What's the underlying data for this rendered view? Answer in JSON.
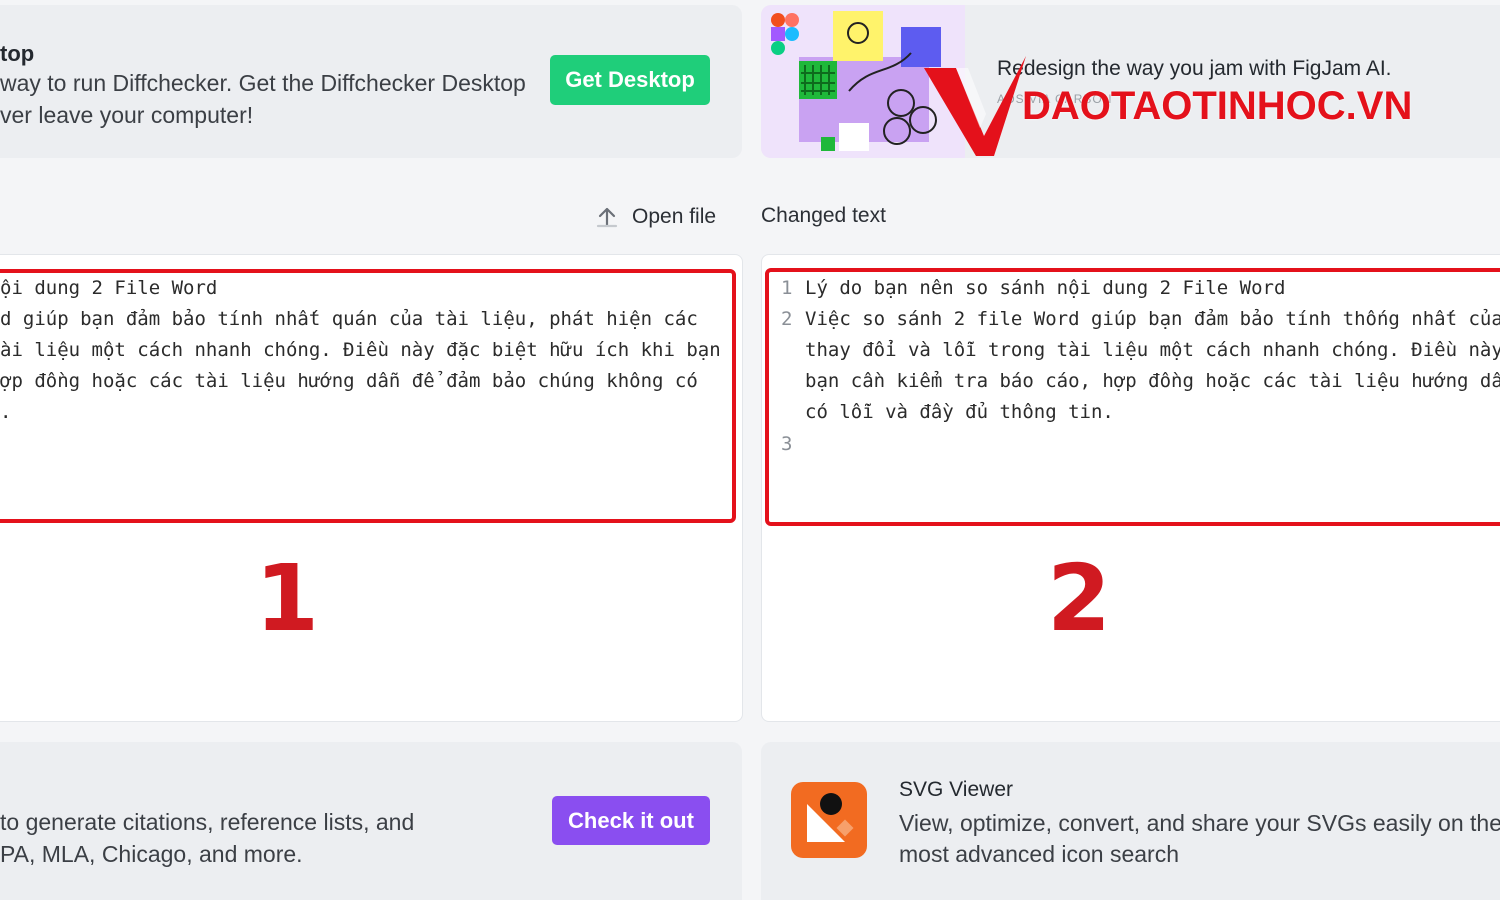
{
  "top_left_promo": {
    "title": "top",
    "line1": "way to run Diffchecker. Get the Diffchecker Desktop",
    "line2": "ver leave your computer!",
    "button": "Get Desktop"
  },
  "top_right_ad": {
    "headline": "Redesign the way you jam with FigJam AI.",
    "sub": "ADS VIA CARBON"
  },
  "watermark": {
    "text": "DAOTAOTINHOC.VN"
  },
  "toolbar": {
    "open_file": "Open file",
    "changed_text_label": "Changed text"
  },
  "left_editor": {
    "lines": [
      "ội dung 2 File Word",
      "d giúp bạn đảm bảo tính nhất quán của tài liệu, phát hiện các",
      "ài liệu một cách nhanh chóng. Điều này đặc biệt hữu ích khi bạn",
      "ợp đồng hoặc các tài liệu hướng dẫn để đảm bảo chúng không có",
      "."
    ],
    "annotation": "1"
  },
  "right_editor": {
    "line_numbers": [
      "1",
      "2",
      "",
      "",
      "",
      "3"
    ],
    "lines": [
      "Lý do bạn nên so sánh nội dung 2 File Word",
      "Việc so sánh 2 file Word giúp bạn đảm bảo tính thống nhất của t",
      "thay đổi và lỗi trong tài liệu một cách nhanh chóng. Điều này đ",
      "bạn cần kiểm tra báo cáo, hợp đồng hoặc các tài liệu hướng dẫn",
      "có lỗi và đầy đủ thông tin.",
      ""
    ],
    "annotation": "2"
  },
  "bottom_left_promo": {
    "line1": "to generate citations, reference lists, and",
    "line2": "PA, MLA, Chicago, and more.",
    "button": "Check it out"
  },
  "bottom_right_promo": {
    "title": "SVG Viewer",
    "line1": "View, optimize, convert, and share your SVGs easily on the web",
    "line2": "most advanced icon search"
  },
  "colors": {
    "green_button": "#1fce7a",
    "purple_button": "#8a4ef0",
    "annotation_red": "#d01a21",
    "svg_icon_orange": "#f26b21"
  }
}
